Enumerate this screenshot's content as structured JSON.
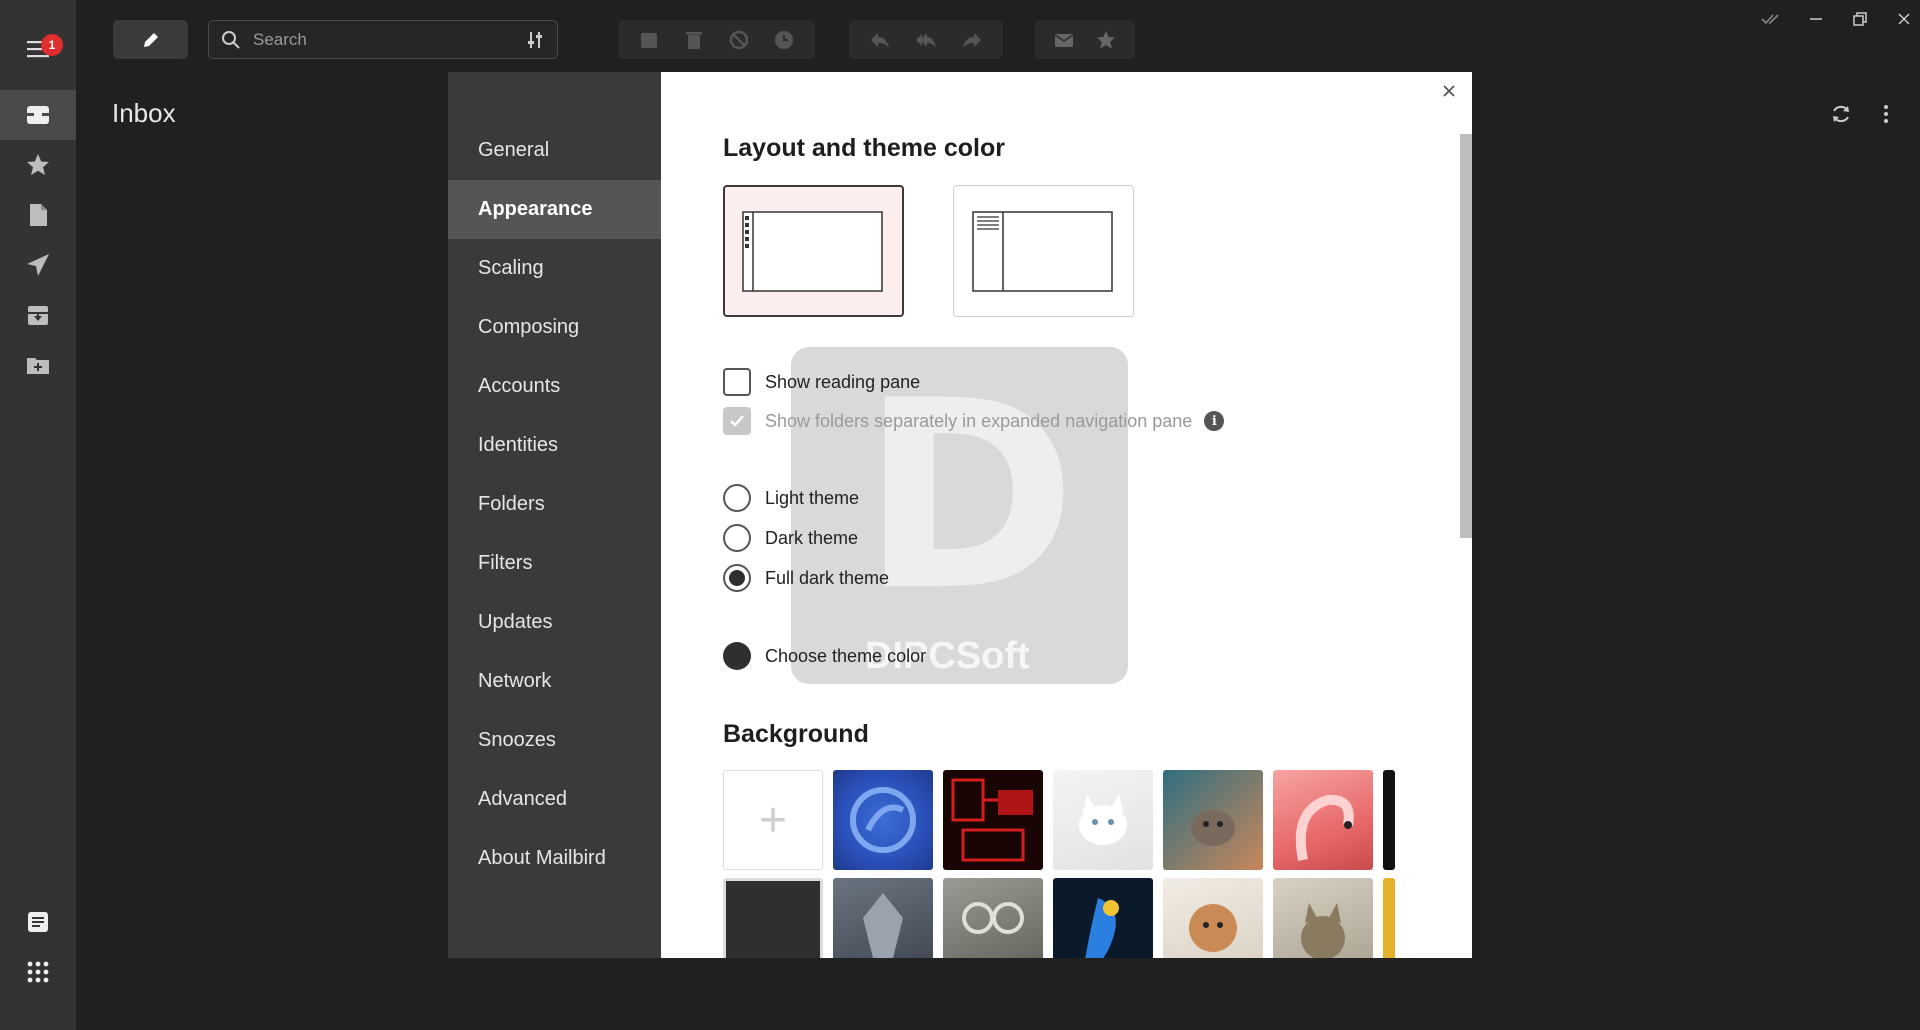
{
  "app": {
    "notification_count": "1"
  },
  "toolbar": {
    "search_placeholder": "Search"
  },
  "mailbox": {
    "title": "Inbox"
  },
  "settings": {
    "nav": [
      {
        "label": "General",
        "active": false
      },
      {
        "label": "Appearance",
        "active": true
      },
      {
        "label": "Scaling",
        "active": false
      },
      {
        "label": "Composing",
        "active": false
      },
      {
        "label": "Accounts",
        "active": false
      },
      {
        "label": "Identities",
        "active": false
      },
      {
        "label": "Folders",
        "active": false
      },
      {
        "label": "Filters",
        "active": false
      },
      {
        "label": "Updates",
        "active": false
      },
      {
        "label": "Network",
        "active": false
      },
      {
        "label": "Snoozes",
        "active": false
      },
      {
        "label": "Advanced",
        "active": false
      },
      {
        "label": "About Mailbird",
        "active": false
      }
    ],
    "appearance": {
      "layout_heading": "Layout and theme color",
      "show_reading_pane": {
        "label": "Show reading pane",
        "checked": false
      },
      "show_folders_separately": {
        "label": "Show folders separately in expanded navigation pane",
        "checked": true,
        "disabled": true
      },
      "themes": [
        {
          "label": "Light theme",
          "selected": false
        },
        {
          "label": "Dark theme",
          "selected": false
        },
        {
          "label": "Full dark theme",
          "selected": true
        }
      ],
      "choose_color_label": "Choose theme color",
      "theme_color": "#2f2f2f",
      "background_heading": "Background"
    }
  },
  "watermark": {
    "letter": "D",
    "text": "DIPCSoft"
  },
  "colors": {
    "rail": "#333333",
    "nav": "#3a3a3a",
    "nav_active": "#555555",
    "panel": "#ffffff",
    "accent_layout": "#fdeeee",
    "badge": "#e02d2d"
  }
}
